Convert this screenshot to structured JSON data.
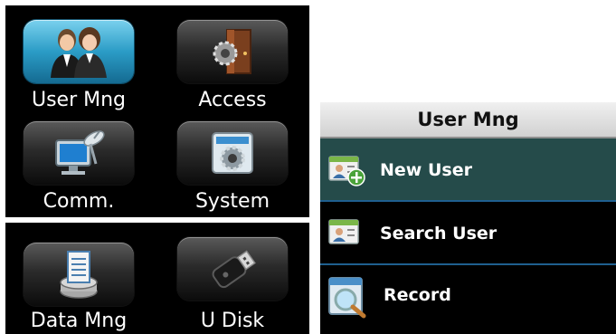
{
  "main_menu": {
    "tiles": [
      {
        "label": "User Mng",
        "icon": "users-icon",
        "selected": true
      },
      {
        "label": "Access",
        "icon": "door-gear-icon"
      },
      {
        "label": "Comm.",
        "icon": "network-computer-icon"
      },
      {
        "label": "System",
        "icon": "system-gear-icon"
      },
      {
        "label": "Data Mng",
        "icon": "database-icon"
      },
      {
        "label": "U Disk",
        "icon": "usb-drive-icon"
      }
    ]
  },
  "submenu": {
    "title": "User Mng",
    "items": [
      {
        "label": "New User",
        "icon": "add-user-icon",
        "selected": true
      },
      {
        "label": "Search User",
        "icon": "search-user-icon"
      },
      {
        "label": "Record",
        "icon": "record-magnifier-icon"
      }
    ]
  },
  "colors": {
    "selected_tile": "#2b9cc6",
    "selected_row": "#254b4a",
    "separator": "#1f5f8f",
    "header_bg": "#e0e0e0"
  }
}
